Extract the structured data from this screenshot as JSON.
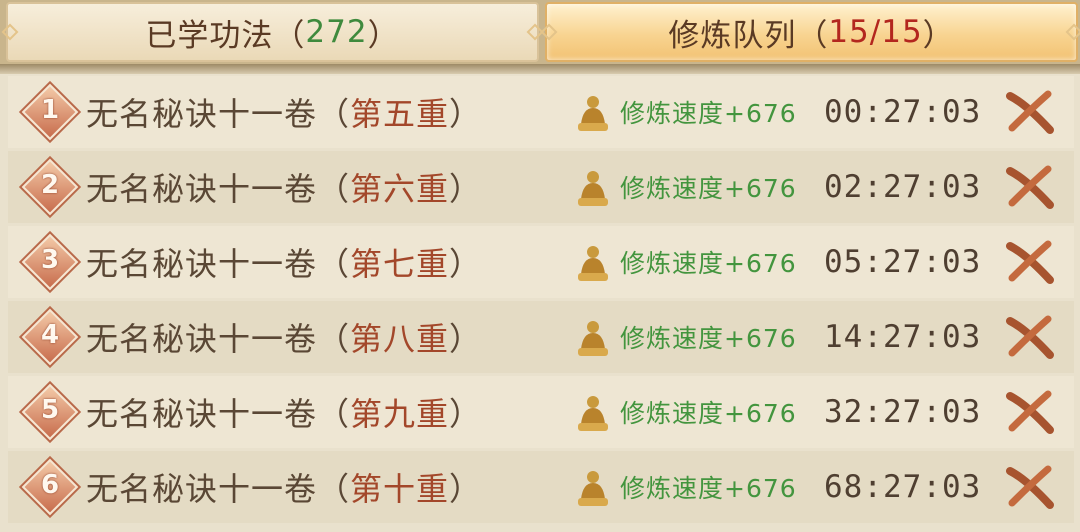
{
  "tabs": [
    {
      "label": "已学功法",
      "open": "（",
      "count": "272",
      "close": "）",
      "active": false
    },
    {
      "label": "修炼队列",
      "open": "（",
      "count": "15/15",
      "close": "）",
      "active": true
    }
  ],
  "queue": [
    {
      "num": "1",
      "name": "无名秘诀十一卷",
      "open": "（",
      "tier": "第五重",
      "close": "）",
      "speed": "修炼速度+676",
      "time": "00:27:03"
    },
    {
      "num": "2",
      "name": "无名秘诀十一卷",
      "open": "（",
      "tier": "第六重",
      "close": "）",
      "speed": "修炼速度+676",
      "time": "02:27:03"
    },
    {
      "num": "3",
      "name": "无名秘诀十一卷",
      "open": "（",
      "tier": "第七重",
      "close": "）",
      "speed": "修炼速度+676",
      "time": "05:27:03"
    },
    {
      "num": "4",
      "name": "无名秘诀十一卷",
      "open": "（",
      "tier": "第八重",
      "close": "）",
      "speed": "修炼速度+676",
      "time": "14:27:03"
    },
    {
      "num": "5",
      "name": "无名秘诀十一卷",
      "open": "（",
      "tier": "第九重",
      "close": "）",
      "speed": "修炼速度+676",
      "time": "32:27:03"
    },
    {
      "num": "6",
      "name": "无名秘诀十一卷",
      "open": "（",
      "tier": "第十重",
      "close": "）",
      "speed": "修炼速度+676",
      "time": "68:27:03"
    }
  ],
  "icons": {
    "speed": "buddha-icon",
    "cancel": "cancel-x-icon",
    "rank": "diamond-badge-icon"
  },
  "colors": {
    "speed_text": "#43953e",
    "tier_text": "#a3472a",
    "count_learned": "#3f8a3d",
    "count_queue": "#b3261e"
  }
}
